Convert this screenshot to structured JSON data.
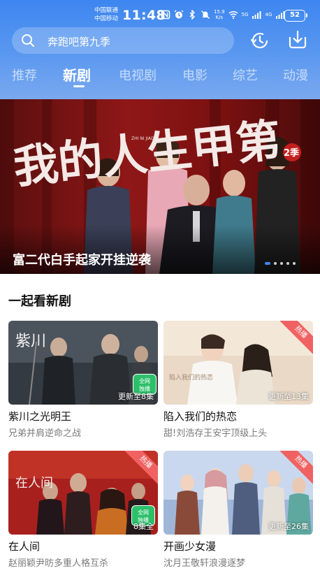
{
  "status_bar": {
    "carrier_1": "中国联通",
    "carrier_2": "中国移动",
    "time": "11:48",
    "net_speed_value": "15.9",
    "net_speed_unit": "K/s",
    "net_5g": "5G",
    "net_4g": "4G",
    "battery": "52"
  },
  "search": {
    "placeholder": "奔跑吧第九季"
  },
  "tabs": [
    {
      "label": "推荐",
      "active": false
    },
    {
      "label": "新剧",
      "active": true
    },
    {
      "label": "电视剧",
      "active": false
    },
    {
      "label": "电影",
      "active": false
    },
    {
      "label": "综艺",
      "active": false
    },
    {
      "label": "动漫",
      "active": false
    }
  ],
  "banner": {
    "caption": "富二代白手起家开挂逆袭",
    "calligraphy": "我的人生甲第",
    "season_tag": "2季",
    "pinyin": "ZHI NI JIADI",
    "dot_count": 5,
    "active_dot": 0
  },
  "section": {
    "title": "一起看新剧"
  },
  "cards": [
    {
      "title": "紫川之光明王",
      "subtitle": "兄弟并肩逆命之战",
      "episode": "更新至8集",
      "poster_text": "紫川",
      "badge": "全网独播",
      "corner_tag": ""
    },
    {
      "title": "陷入我们的热恋",
      "subtitle": "甜!刘浩存王安宇顶级上头",
      "episode": "更新至13集",
      "poster_text": "陷入我们的热恋",
      "badge": "",
      "corner_tag": "热播"
    },
    {
      "title": "在人间",
      "subtitle": "赵丽颖尹昉多重人格互杀",
      "episode": "8集全",
      "poster_text": "在人间",
      "badge": "全网独播",
      "corner_tag": "热播"
    },
    {
      "title": "开画少女漫",
      "subtitle": "沈月王敬轩浪漫逐梦",
      "episode": "更新至26集",
      "poster_text": "",
      "badge": "",
      "corner_tag": "热播"
    }
  ],
  "colors": {
    "header_blue": "#3d86f0",
    "hot_tag": "#f06262",
    "exclusive_green": "#2cc06a"
  }
}
